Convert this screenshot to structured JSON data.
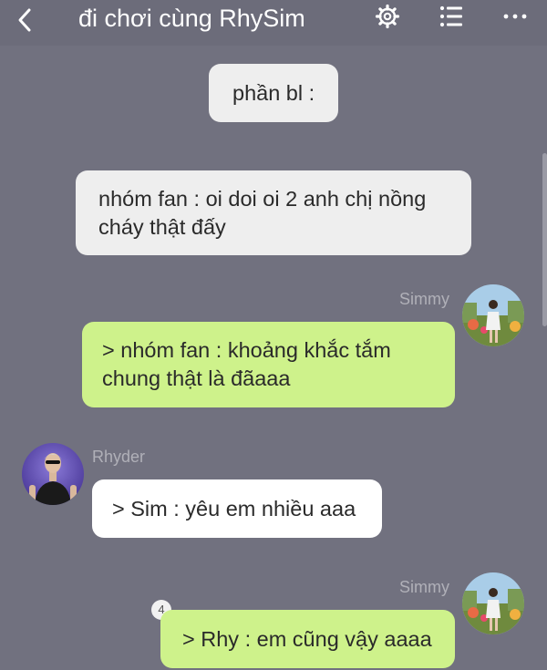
{
  "header": {
    "title": "đi chơi cùng RhySim"
  },
  "messages": {
    "m1": {
      "text": "phần bl :"
    },
    "m2": {
      "text": "nhóm fan : oi doi oi 2 anh chị nồng cháy thật đấy"
    },
    "m3": {
      "sender": "Simmy",
      "text": "> nhóm fan :  khoảng khắc tắm chung thật là đãaaa"
    },
    "m4": {
      "sender": "Rhyder",
      "text": "> Sim : yêu em nhiều aaa"
    },
    "m5": {
      "sender": "Simmy",
      "text": "> Rhy : em cũng vậy aaaa",
      "badge": "4"
    }
  },
  "colors": {
    "background": "#71717f",
    "header": "#6c6c7a",
    "my_bubble": "#cef28b",
    "other_bubble": "#ffffff",
    "system_bubble": "#eeeeee"
  }
}
